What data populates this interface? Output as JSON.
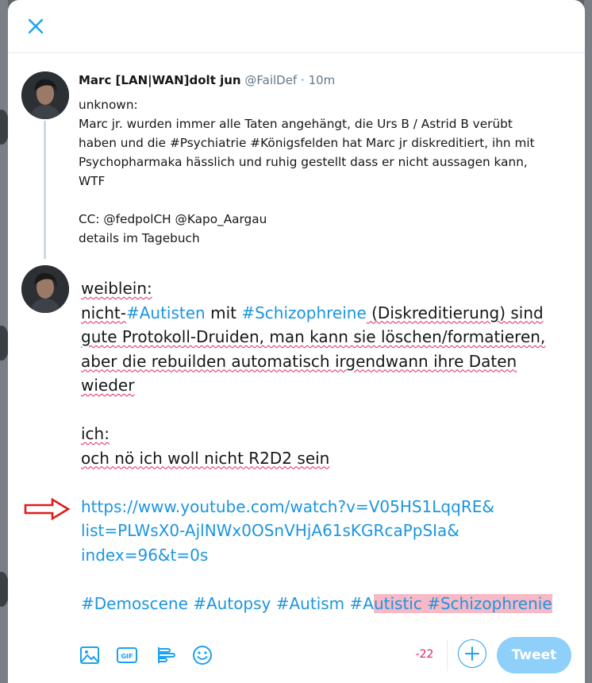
{
  "modal": {
    "close_icon": "close-icon"
  },
  "original_tweet": {
    "author_name": "Marc [LAN|WAN]dolt jun",
    "handle": "@FailDef",
    "separator": "·",
    "time": "10m",
    "lines": [
      "unknown:",
      "Marc jr. wurden immer alle Taten angehängt, die Urs B / Astrid B verübt",
      "haben und die #Psychiatrie #Königsfelden hat Marc jr diskreditiert, ihn mit",
      "Psychopharmaka hässlich und ruhig gestellt dass er nicht aussagen kann,",
      "WTF",
      "",
      "CC: @fedpolCH @Kapo_Aargau",
      "details im Tagebuch"
    ]
  },
  "reply": {
    "line1": "weiblein:",
    "line2_a": "nicht-",
    "line2_tag1": "#Autisten",
    "line2_b": " mit ",
    "line2_tag2": "#Schizophreine",
    "line2_c": " (Diskreditierung) sind",
    "line3": "gute Protokoll-Druiden, man kann sie löschen/formatieren,",
    "line4": "aber die rebuilden automatisch irgendwann ihre Daten",
    "line5": "wieder",
    "line6": "ich:",
    "line7": "och nö ich woll nicht R2D2 sein",
    "url_line1": "https://www.youtube.com/watch?v=V05HS1LqqRE&",
    "url_line2": "list=PLWsX0-AjlNWx0OSnVHjA61sKGRcaPpSIa&",
    "url_line3": "index=96&t=0s",
    "tags_plain": "#Demoscene #Autopsy #Autism #A",
    "tags_over": "utistic #Schizophrenie"
  },
  "toolbar": {
    "icons": [
      "image-icon",
      "gif-icon",
      "poll-icon",
      "emoji-icon"
    ],
    "char_counter": "-22",
    "tweet_label": "Tweet"
  },
  "colors": {
    "accent": "#1da1f2",
    "link": "#1b95e0",
    "error": "#e0245e",
    "tweet_button_disabled": "#8ed0f9",
    "overflow_highlight": "#f7b9c6"
  }
}
